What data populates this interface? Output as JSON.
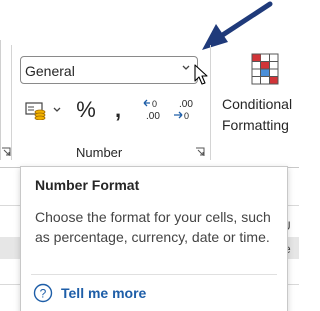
{
  "number_group": {
    "format_dropdown": {
      "value": "General",
      "icon": "chevron-down-icon"
    },
    "commands": [
      {
        "name": "accounting-format",
        "icon": "accounting-number-format-icon"
      },
      {
        "name": "accounting-dropdown",
        "icon": "chevron-down-icon"
      },
      {
        "name": "percent-style",
        "label": "%"
      },
      {
        "name": "comma-style",
        "label": ","
      },
      {
        "name": "increase-decimal",
        "icon": "increase-decimal-icon",
        "text": ".00"
      },
      {
        "name": "decrease-decimal",
        "icon": "decrease-decimal-icon",
        "text": ".00"
      }
    ],
    "label": "Number",
    "launcher_icon": "dialog-launcher-icon"
  },
  "styles_group": {
    "conditional_formatting": {
      "line1": "Conditional",
      "line2": "Formatting",
      "icon": "conditional-formatting-icon"
    }
  },
  "tooltip": {
    "title": "Number Format",
    "body": "Choose the format for your cells, such as percentage, currency, date or time.",
    "help": {
      "label": "Tell me more",
      "icon": "help-circle-icon"
    }
  },
  "annotation": {
    "icon": "pointer-arrow-icon",
    "color": "#1f3a7a"
  },
  "colors": {
    "accent_red": "#d13438",
    "link_blue": "#1e5ea8",
    "arrow_navy": "#1f3a7a"
  }
}
